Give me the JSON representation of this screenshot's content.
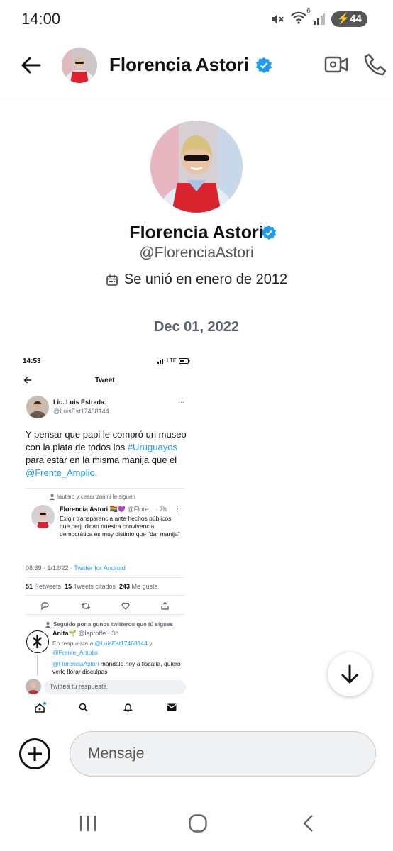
{
  "status_bar": {
    "time": "14:00",
    "signal_badge": "6",
    "battery": "44"
  },
  "header": {
    "name": "Florencia Astori"
  },
  "profile": {
    "name": "Florencia Astori",
    "handle": "@FlorenciaAstori",
    "joined": "Se unió en enero de 2012"
  },
  "conversation": {
    "date_separator": "Dec 01, 2022"
  },
  "shared_screenshot": {
    "time": "14:53",
    "network": "LTE",
    "title": "Tweet",
    "author_name": "Lic. Luis Estrada.",
    "author_handle": "@LuisEst17468144",
    "text_part1": "Y pensar que papi le compró un museo con la plata de todos los ",
    "hashtag": "#Uruguayos",
    "text_part2": " para estar en la misma manija que el ",
    "mention": "@Frente_Amplio",
    "text_end": ".",
    "quote_context": "lautaro y cesar zanini le siguen",
    "quote_name": "Florencia Astori",
    "quote_flags": "🏳️‍🌈💜",
    "quote_handle": "@Flore...",
    "quote_time": "· 7h",
    "quote_text": "Exigir transparencia ante hechos públicos que perjudican nuestra convivencia democrática es muy distinto que “dar manija”",
    "timestamp": "08:39 · 1/12/22 · ",
    "source": "Twitter for Android",
    "retweets_count": "51",
    "retweets_label": "Retweets",
    "quotes_count": "15",
    "quotes_label": "Tweets citados",
    "likes_count": "243",
    "likes_label": "Me gusta",
    "reply_context": "Seguido por algunos twitteros que tú sigues",
    "reply_name": "Anita🌱",
    "reply_handle": "@laproffe · 3h",
    "reply_intro": "En respuesta a ",
    "reply_mention1": "@LuisEst17468144",
    "reply_and": " y",
    "reply_mention2": "@Frente_Amplio",
    "reply_mention3": "@FlorenciaAstori",
    "reply_text": " mándalo hoy a fiscalía, quiero verlo llorar disculpas",
    "compose_placeholder": "Twittea tu respuesta"
  },
  "composer": {
    "placeholder": "Mensaje"
  },
  "colors": {
    "verified": "#1d9bf0",
    "link": "#1d9bf0",
    "dress": "#d9232e"
  }
}
